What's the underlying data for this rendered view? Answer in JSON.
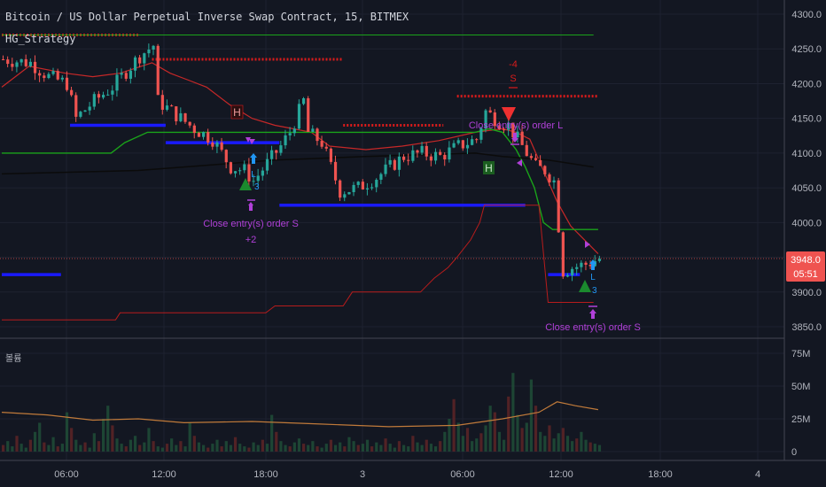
{
  "header": {
    "symbol_title": "Bitcoin / US Dollar Perpetual Inverse Swap Contract, 15, BITMEX",
    "study_name": "HG_Strategy"
  },
  "volume_pane": {
    "label": "볼륨"
  },
  "price_badge": {
    "price": "3948.0",
    "countdown": "05:51"
  },
  "colors": {
    "background": "#131722",
    "grid": "#1e2230",
    "up": "#26a69a",
    "down": "#ef5350",
    "support": "#1a1aff",
    "resistance": "#d81b1b",
    "green_line": "#1aa31a",
    "annotation": "#b040d8",
    "axis_text": "#b2b5be"
  },
  "annotations": {
    "close_s_1": "Close entry(s) order S",
    "close_s_1_profit": "+2",
    "close_l": "Close entry(s) order L",
    "close_s_2": "Close entry(s) order S",
    "sell_qty": "-4",
    "sell_letter": "S",
    "h_marker_1": "H",
    "h_marker_2": "H",
    "long_letter": "L",
    "long_letter_2": "L",
    "triangle_num_1": "3",
    "triangle_num_2": "3"
  },
  "chart_data": [
    {
      "type": "candlestick",
      "title": "Bitcoin / US Dollar Perpetual Inverse Swap Contract, 15, BITMEX",
      "x_tick_labels": [
        "06:00",
        "12:00",
        "18:00",
        "3",
        "06:00",
        "12:00",
        "18:00",
        "4"
      ],
      "y_tick_labels": [
        "4300.0",
        "4250.0",
        "4200.0",
        "4150.0",
        "4100.0",
        "4050.0",
        "4000.0",
        "3950.0",
        "3900.0",
        "3850.0"
      ],
      "ylim": [
        3830,
        4310
      ],
      "last_price": 3948.0,
      "close_path": [
        [
          0,
          4235
        ],
        [
          6,
          4230
        ],
        [
          10,
          4210
        ],
        [
          14,
          4200
        ],
        [
          16,
          4150
        ],
        [
          20,
          4175
        ],
        [
          24,
          4195
        ],
        [
          30,
          4240
        ],
        [
          33,
          4255
        ],
        [
          34,
          4175
        ],
        [
          38,
          4155
        ],
        [
          42,
          4135
        ],
        [
          46,
          4120
        ],
        [
          50,
          4080
        ],
        [
          53,
          4075
        ],
        [
          55,
          4060
        ],
        [
          58,
          4085
        ],
        [
          61,
          4110
        ],
        [
          63,
          4130
        ],
        [
          66,
          4175
        ],
        [
          67,
          4130
        ],
        [
          70,
          4115
        ],
        [
          74,
          4045
        ],
        [
          78,
          4050
        ],
        [
          82,
          4065
        ],
        [
          85,
          4080
        ],
        [
          88,
          4095
        ],
        [
          92,
          4100
        ],
        [
          96,
          4095
        ],
        [
          100,
          4110
        ],
        [
          104,
          4120
        ],
        [
          106,
          4160
        ],
        [
          109,
          4145
        ],
        [
          111,
          4140
        ],
        [
          113,
          4120
        ],
        [
          115,
          4100
        ],
        [
          117,
          4080
        ],
        [
          119,
          4075
        ],
        [
          121,
          4060
        ],
        [
          123,
          3930
        ],
        [
          125,
          3935
        ],
        [
          128,
          3940
        ],
        [
          131,
          3948
        ]
      ],
      "support_levels": [
        {
          "from": 15,
          "to": 36,
          "y": 4140
        },
        {
          "from": 36,
          "to": 61,
          "y": 4115
        },
        {
          "from": 61,
          "to": 115,
          "y": 4025
        },
        {
          "from": 0,
          "to": 13,
          "y": 3925
        },
        {
          "from": 120,
          "to": 127,
          "y": 3925
        }
      ],
      "resistance_levels": [
        {
          "from": 0,
          "to": 30,
          "y": 4270
        },
        {
          "from": 33,
          "to": 75,
          "y": 4235
        },
        {
          "from": 75,
          "to": 97,
          "y": 4140
        },
        {
          "from": 100,
          "to": 131,
          "y": 4182
        }
      ],
      "series": [
        {
          "type": "line",
          "values": [
            [
              0,
              4195
            ],
            [
              6,
              4225
            ],
            [
              14,
              4215
            ],
            [
              20,
              4210
            ],
            [
              26,
              4215
            ],
            [
              33,
              4230
            ],
            [
              37,
              4215
            ],
            [
              41,
              4205
            ],
            [
              45,
              4195
            ],
            [
              50,
              4170
            ],
            [
              55,
              4150
            ],
            [
              60,
              4140
            ],
            [
              64,
              4135
            ],
            [
              68,
              4130
            ],
            [
              72,
              4110
            ],
            [
              80,
              4105
            ],
            [
              88,
              4110
            ],
            [
              96,
              4118
            ],
            [
              104,
              4130
            ],
            [
              110,
              4135
            ],
            [
              113,
              4130
            ],
            [
              116,
              4120
            ],
            [
              119,
              4075
            ],
            [
              122,
              4030
            ],
            [
              125,
              3995
            ],
            [
              128,
              3975
            ],
            [
              131,
              3955
            ]
          ]
        },
        {
          "type": "line",
          "values": [
            [
              0,
              4100
            ],
            [
              24,
              4100
            ],
            [
              27,
              4115
            ],
            [
              32,
              4130
            ],
            [
              40,
              4130
            ],
            [
              60,
              4130
            ],
            [
              80,
              4130
            ],
            [
              104,
              4130
            ],
            [
              107,
              4135
            ],
            [
              110,
              4130
            ],
            [
              113,
              4105
            ],
            [
              115,
              4080
            ],
            [
              117,
              4050
            ],
            [
              119,
              4000
            ],
            [
              121,
              3990
            ],
            [
              131,
              3990
            ]
          ]
        },
        {
          "type": "line",
          "values": [
            [
              0,
              4270
            ],
            [
              33,
              4270
            ],
            [
              33,
              4270
            ],
            [
              60,
              4270
            ],
            [
              100,
              4270
            ],
            [
              130,
              4270
            ]
          ]
        },
        {
          "type": "line",
          "values": [
            [
              0,
              3860
            ],
            [
              25,
              3860
            ],
            [
              26,
              3870
            ],
            [
              58,
              3870
            ],
            [
              60,
              3880
            ],
            [
              75,
              3880
            ],
            [
              77,
              3900
            ],
            [
              92,
              3900
            ],
            [
              95,
              3920
            ],
            [
              98,
              3935
            ],
            [
              100,
              3950
            ],
            [
              103,
              3975
            ],
            [
              105,
              4000
            ],
            [
              106,
              4025
            ],
            [
              118,
              4025
            ],
            [
              120,
              3885
            ],
            [
              130,
              3885
            ]
          ]
        },
        {
          "type": "line",
          "values": [
            [
              0,
              4070
            ],
            [
              30,
              4075
            ],
            [
              40,
              4080
            ],
            [
              60,
              4090
            ],
            [
              80,
              4095
            ],
            [
              104,
              4100
            ],
            [
              110,
              4095
            ],
            [
              120,
              4090
            ],
            [
              130,
              4080
            ]
          ]
        }
      ]
    },
    {
      "type": "bar",
      "title": "볼륨",
      "y_tick_labels": [
        "75M",
        "50M",
        "25M",
        "0"
      ],
      "ylim": [
        0,
        80
      ],
      "values": [
        5,
        8,
        4,
        12,
        6,
        3,
        9,
        15,
        22,
        7,
        5,
        11,
        4,
        6,
        30,
        18,
        9,
        5,
        7,
        3,
        14,
        8,
        25,
        35,
        20,
        10,
        6,
        4,
        9,
        12,
        5,
        7,
        18,
        8,
        4,
        3,
        6,
        10,
        5,
        8,
        4,
        22,
        12,
        7,
        5,
        3,
        6,
        9,
        4,
        8,
        5,
        11,
        6,
        4,
        3,
        7,
        5,
        9,
        6,
        28,
        15,
        8,
        5,
        4,
        7,
        10,
        6,
        5,
        8,
        4,
        3,
        6,
        9,
        5,
        7,
        4,
        11,
        8,
        5,
        6,
        9,
        4,
        7,
        5,
        10,
        6,
        3,
        8,
        5,
        4,
        12,
        7,
        5,
        9,
        6,
        4,
        8,
        15,
        25,
        40,
        22,
        12,
        18,
        8,
        10,
        14,
        20,
        35,
        30,
        15,
        9,
        42,
        60,
        28,
        18,
        22,
        55,
        35,
        15,
        12,
        20,
        10,
        14,
        18,
        12,
        8,
        10,
        15,
        9,
        7,
        6,
        5
      ],
      "average": [
        [
          0,
          30
        ],
        [
          10,
          28
        ],
        [
          20,
          24
        ],
        [
          30,
          25
        ],
        [
          40,
          22
        ],
        [
          55,
          23
        ],
        [
          70,
          21
        ],
        [
          85,
          19
        ],
        [
          100,
          20
        ],
        [
          110,
          25
        ],
        [
          118,
          30
        ],
        [
          122,
          38
        ],
        [
          126,
          35
        ],
        [
          131,
          32
        ]
      ]
    }
  ]
}
